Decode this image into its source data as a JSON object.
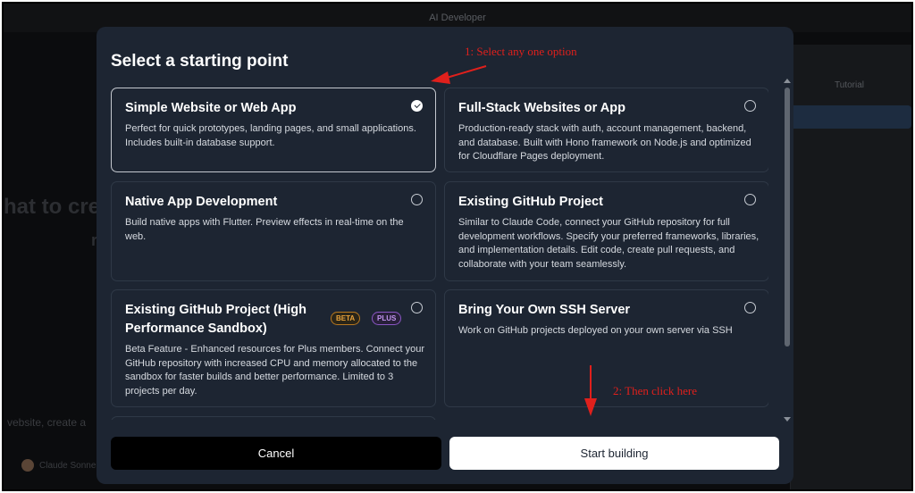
{
  "background": {
    "window_title": "AI Developer",
    "tabs": [
      "Tutorial"
    ],
    "hero_text_fragment": "hat to cre",
    "hero_text_fragment2": "r",
    "input_fragment": "vebsite, create a",
    "user_fragment": "Claude Sonne"
  },
  "modal": {
    "title": "Select a starting point",
    "options": [
      {
        "title": "Simple Website or Web App",
        "description": "Perfect for quick prototypes, landing pages, and small applications. Includes built-in database support.",
        "selected": true
      },
      {
        "title": "Full-Stack Websites or App",
        "description": "Production-ready stack with auth, account management, backend, and database. Built with Hono framework on Node.js and optimized for Cloudflare Pages deployment.",
        "selected": false
      },
      {
        "title": "Native App Development",
        "description": "Build native apps with Flutter. Preview effects in real-time on the web.",
        "selected": false
      },
      {
        "title": "Existing GitHub Project",
        "description": "Similar to Claude Code, connect your GitHub repository for full development workflows. Specify your preferred frameworks, libraries, and implementation details. Edit code, create pull requests, and collaborate with your team seamlessly.",
        "selected": false
      },
      {
        "title": "Existing GitHub Project (High Performance Sandbox)",
        "description": "Beta Feature - Enhanced resources for Plus members. Connect your GitHub repository with increased CPU and memory allocated to the sandbox for faster builds and better performance. Limited to 3 projects per day.",
        "badges": [
          "BETA",
          "PLUS"
        ],
        "selected": false
      },
      {
        "title": "Bring Your Own SSH Server",
        "description": "Work on GitHub projects deployed on your own server via SSH",
        "selected": false
      }
    ],
    "cancel_label": "Cancel",
    "start_label": "Start building"
  },
  "annotations": {
    "step1": "1: Select any one option",
    "step2": "2: Then click here",
    "color": "#e0201c"
  }
}
